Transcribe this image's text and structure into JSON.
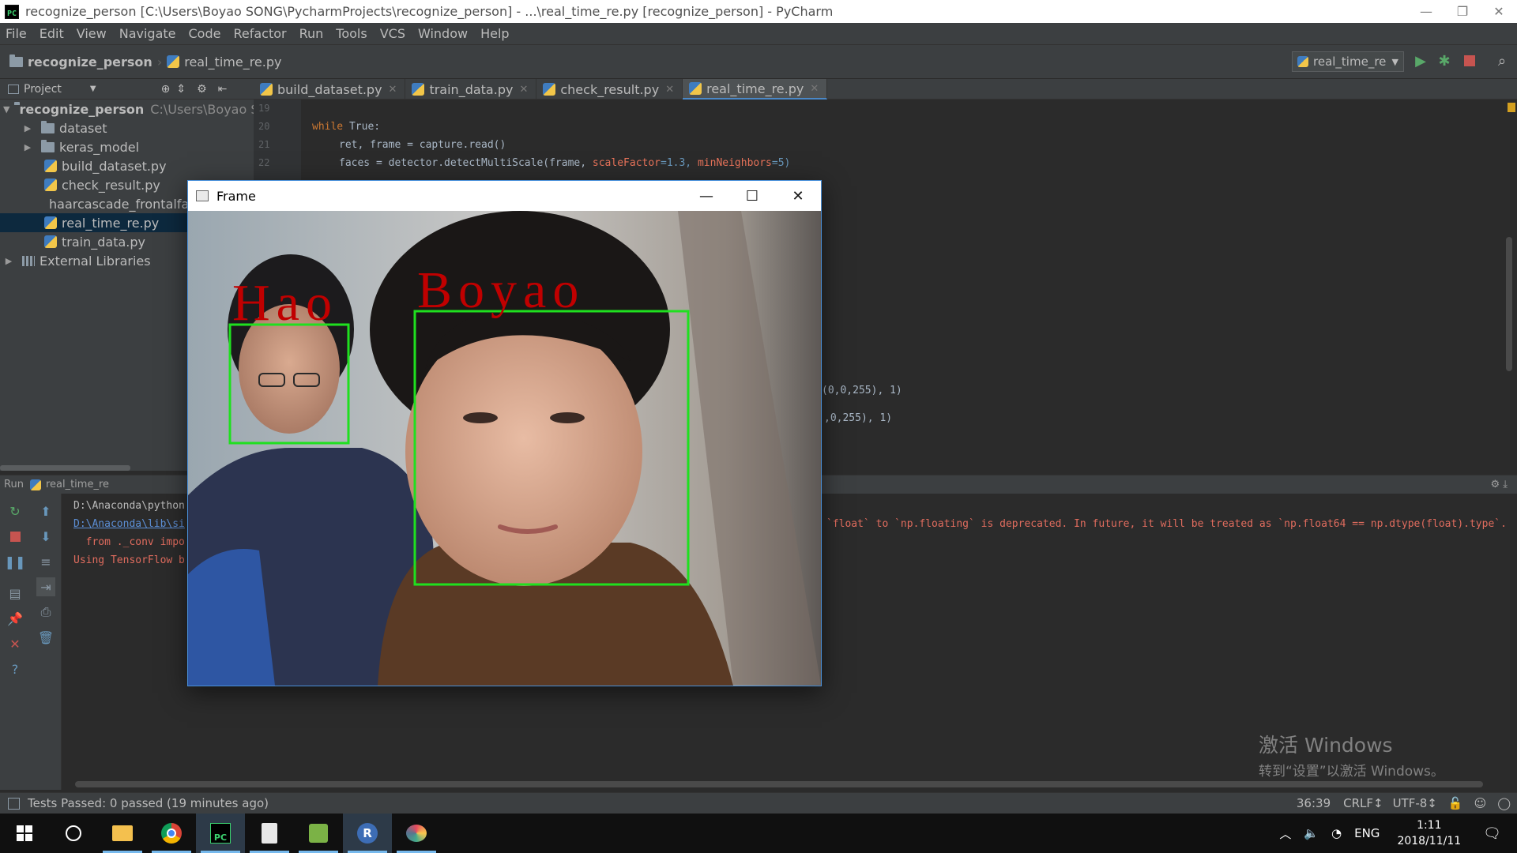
{
  "window": {
    "title": "recognize_person [C:\\Users\\Boyao SONG\\PycharmProjects\\recognize_person] - ...\\real_time_re.py [recognize_person] - PyCharm",
    "minimize": "—",
    "restore": "❐",
    "close": "✕"
  },
  "menu": [
    "File",
    "Edit",
    "View",
    "Navigate",
    "Code",
    "Refactor",
    "Run",
    "Tools",
    "VCS",
    "Window",
    "Help"
  ],
  "breadcrumb": {
    "project": "recognize_person",
    "file": "real_time_re.py"
  },
  "toolbar": {
    "run_config": "real_time_re"
  },
  "project_panel": {
    "header": "Project",
    "root_name": "recognize_person",
    "root_path": "C:\\Users\\Boyao SONG",
    "items": [
      {
        "label": "dataset",
        "type": "folder"
      },
      {
        "label": "keras_model",
        "type": "folder"
      },
      {
        "label": "build_dataset.py",
        "type": "py"
      },
      {
        "label": "check_result.py",
        "type": "py"
      },
      {
        "label": "haarcascade_frontalface_default.xml",
        "type": "xml"
      },
      {
        "label": "real_time_re.py",
        "type": "py"
      },
      {
        "label": "train_data.py",
        "type": "py"
      }
    ],
    "external": "External Libraries"
  },
  "tabs": [
    "build_dataset.py",
    "train_data.py",
    "check_result.py",
    "real_time_re.py"
  ],
  "editor": {
    "line_numbers": [
      "19",
      "20",
      "21",
      "22"
    ],
    "line1_kw": "while",
    "line1_rest": " True:",
    "line2": "ret, frame = capture.read()",
    "line3_a": "faces = detector.detectMultiScale(frame, ",
    "line3_p1": "scaleFactor",
    "line3_v1": "=1.3, ",
    "line3_p2": "minNeighbors",
    "line3_v2": "=5)",
    "frag1": "(0,0,255), 1)",
    "frag2": ",0,255), 1)"
  },
  "run_panel": {
    "label": "Run",
    "config": "real_time_re",
    "lines": [
      "D:\\Anaconda\\python",
      "D:\\Anaconda\\lib\\si",
      "  from ._conv impo",
      "Using TensorFlow b"
    ],
    "warning_tail": "`float` to `np.floating` is deprecated. In future, it will be treated as `np.float64 == np.dtype(float).type`."
  },
  "status": {
    "tests": "Tests Passed: 0 passed (19 minutes ago)",
    "position": "36:39",
    "line_sep": "CRLF↕",
    "encoding": "UTF-8↕"
  },
  "watermark": {
    "line1": "激活 Windows",
    "line2": "转到“设置”以激活 Windows。"
  },
  "taskbar": {
    "lang": "ENG",
    "time": "1:11",
    "date": "2018/11/11"
  },
  "frame_window": {
    "title": "Frame",
    "labels": [
      {
        "name": "Hao"
      },
      {
        "name": "Boyao"
      }
    ]
  },
  "colors": {
    "accent": "#4a88c7",
    "box": "#1fe01f",
    "label_red": "#c00000"
  }
}
